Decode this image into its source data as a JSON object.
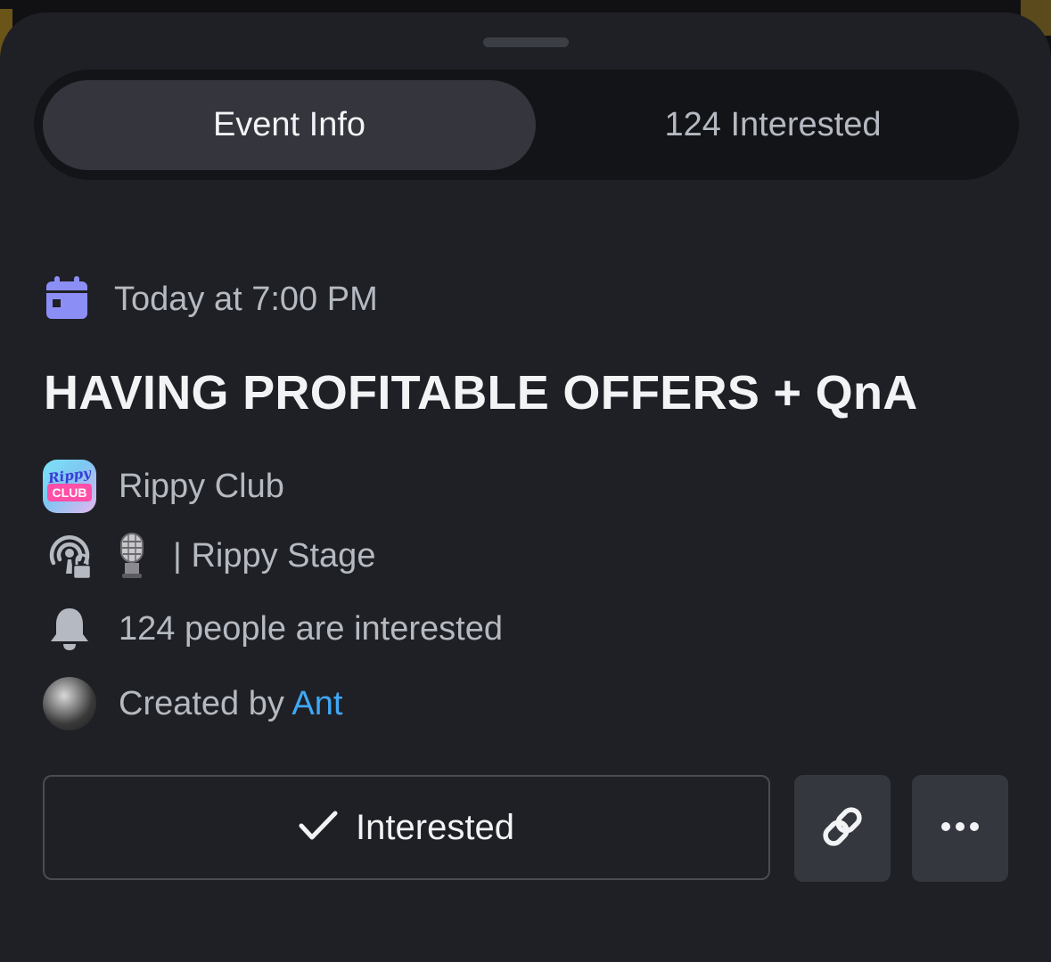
{
  "tabs": {
    "event_info": "Event Info",
    "interested": "124 Interested"
  },
  "event": {
    "date": "Today at 7:00 PM",
    "title": "HAVING PROFITABLE OFFERS + QnA",
    "server_name": "Rippy Club",
    "server_logo_line1": "Rippy",
    "server_logo_line2": "CLUB",
    "channel_separator": "|",
    "channel_name": "Rippy Stage",
    "interested_text": "124 people are interested",
    "created_by_prefix": "Created by",
    "creator_name": "Ant"
  },
  "actions": {
    "interested_label": "Interested"
  },
  "colors": {
    "accent_calendar": "#8b8ff5",
    "link": "#40a8f5",
    "sheet_bg": "#1f2025"
  },
  "icons": {
    "date": "calendar-icon",
    "stage": "stage-lock-icon",
    "mic": "microphone-icon",
    "interested": "bell-icon",
    "check": "checkmark-icon",
    "share": "link-icon",
    "more": "ellipsis-icon"
  }
}
